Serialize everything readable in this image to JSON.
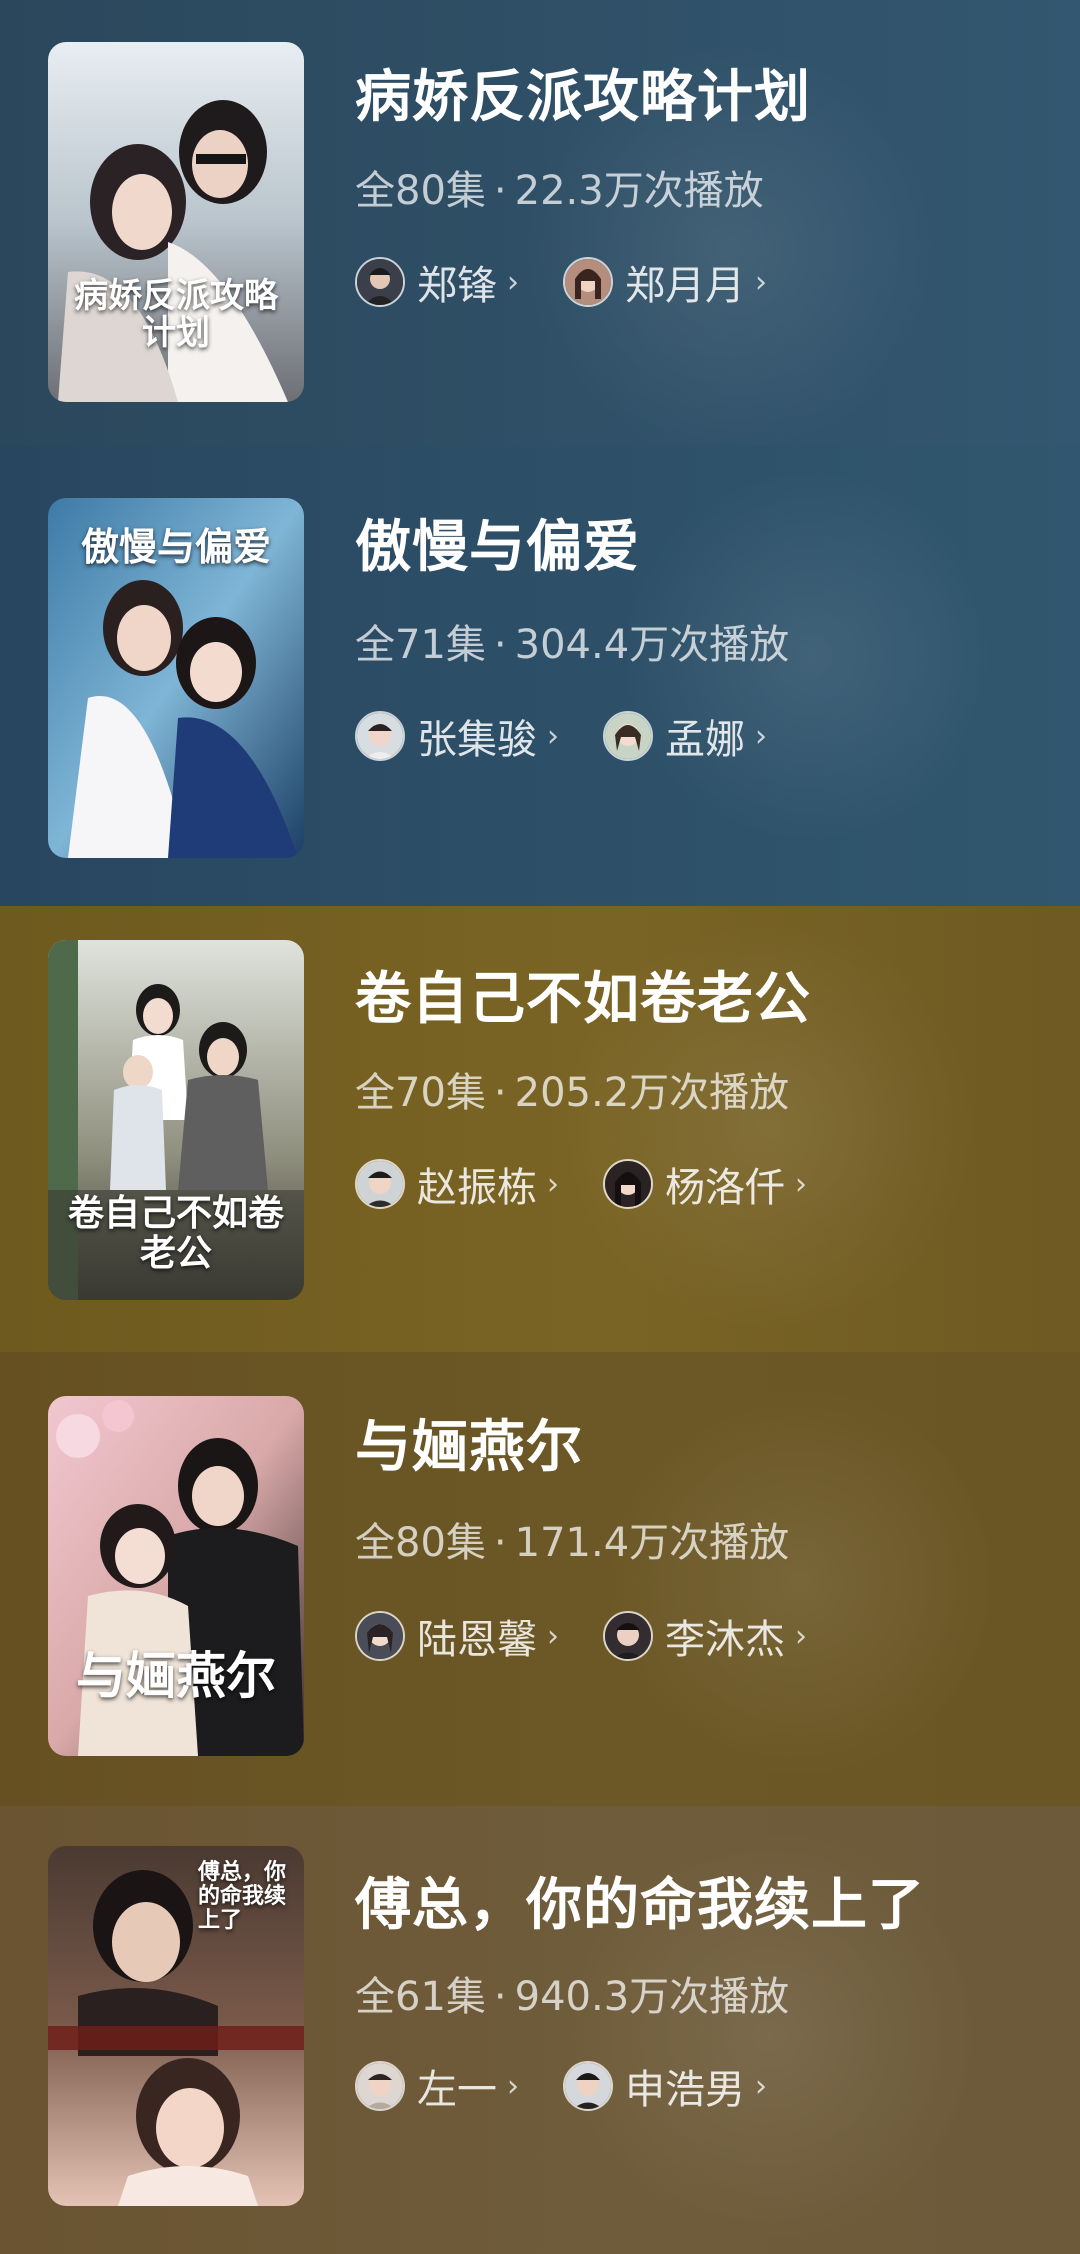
{
  "dramas": [
    {
      "title": "病娇反派攻略计划",
      "episodes": "全80集",
      "separator": "·",
      "plays": "22.3万次播放",
      "poster_text": "病娇反派攻略计划",
      "actors": [
        {
          "name": "郑锋",
          "chevron": "›"
        },
        {
          "name": "郑月月",
          "chevron": "›"
        }
      ]
    },
    {
      "title": "傲慢与偏爱",
      "episodes": "全71集",
      "separator": "·",
      "plays": "304.4万次播放",
      "poster_text": "傲慢与偏爱",
      "actors": [
        {
          "name": "张集骏",
          "chevron": "›"
        },
        {
          "name": "孟娜",
          "chevron": "›"
        }
      ]
    },
    {
      "title": "卷自己不如卷老公",
      "episodes": "全70集",
      "separator": "·",
      "plays": "205.2万次播放",
      "poster_text": "卷自己不如卷老公",
      "actors": [
        {
          "name": "赵振栋",
          "chevron": "›"
        },
        {
          "name": "杨洛仟",
          "chevron": "›"
        }
      ]
    },
    {
      "title": "与婳燕尔",
      "episodes": "全80集",
      "separator": "·",
      "plays": "171.4万次播放",
      "poster_text": "与婳燕尔",
      "actors": [
        {
          "name": "陆恩馨",
          "chevron": "›"
        },
        {
          "name": "李沐杰",
          "chevron": "›"
        }
      ]
    },
    {
      "title": "傅总，你的命我续上了",
      "episodes": "全61集",
      "separator": "·",
      "plays": "940.3万次播放",
      "poster_text": "傅总，你的命我续上了",
      "actors": [
        {
          "name": "左一",
          "chevron": "›"
        },
        {
          "name": "申浩男",
          "chevron": "›"
        }
      ]
    }
  ],
  "colors": {
    "card_bg_blue": "#2c4b63",
    "card_bg_blue_2": "#2e5068",
    "card_bg_gold": "#7a6420",
    "card_bg_gold_2": "#6e5a22",
    "card_bg_brown": "#6b5a36"
  }
}
